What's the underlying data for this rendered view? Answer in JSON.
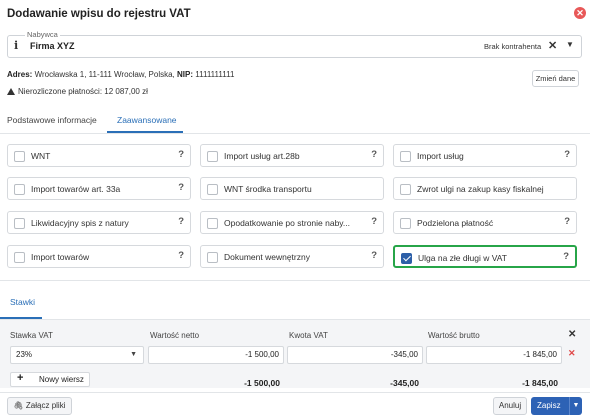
{
  "dialog": {
    "title": "Dodawanie wpisu do rejestru VAT"
  },
  "buyer": {
    "legend": "Nabywca",
    "name": "Firma XYZ",
    "tag": "Brak kontrahenta",
    "clear_icon": "close-icon",
    "caret_icon": "caret-down-icon"
  },
  "address": {
    "label_adres": "Adres:",
    "address_text": "Wrocławska 1, 11-111 Wrocław, Polska,",
    "label_nip": "NIP:",
    "nip": "1111111111",
    "unpaid": "Nierozliczone płatności: 12 087,00 zł",
    "change_button": "Zmień dane"
  },
  "tabs": [
    {
      "label": "Podstawowe informacje",
      "active": false
    },
    {
      "label": "Zaawansowane",
      "active": true
    }
  ],
  "options": [
    {
      "label": "WNT",
      "checked": false,
      "help": "?"
    },
    {
      "label": "Import usług art.28b",
      "checked": false,
      "help": "?"
    },
    {
      "label": "Import usług",
      "checked": false,
      "help": "?"
    },
    {
      "label": "Import towarów art. 33a",
      "checked": false,
      "help": "?"
    },
    {
      "label": "WNT środka transportu",
      "checked": false,
      "help": ""
    },
    {
      "label": "Zwrot ulgi na zakup kasy fiskalnej",
      "checked": false,
      "help": ""
    },
    {
      "label": "Likwidacyjny spis z natury",
      "checked": false,
      "help": "?"
    },
    {
      "label": "Opodatkowanie po stronie naby...",
      "checked": false,
      "help": "?"
    },
    {
      "label": "Podzielona płatność",
      "checked": false,
      "help": "?"
    },
    {
      "label": "Import towarów",
      "checked": false,
      "help": "?"
    },
    {
      "label": "Dokument wewnętrzny",
      "checked": false,
      "help": "?"
    },
    {
      "label": "Ulga na złe długi w VAT",
      "checked": true,
      "help": "?"
    }
  ],
  "rates": {
    "tab_label": "Stawki",
    "headers": [
      "Stawka VAT",
      "Wartość netto",
      "Kwota VAT",
      "Wartość brutto"
    ],
    "row": {
      "rate": "23%",
      "net": "-1 500,00",
      "vat": "-345,00",
      "gross": "-1 845,00"
    },
    "new_row_label": "Nowy wiersz",
    "totals": {
      "net": "-1 500,00",
      "vat": "-345,00",
      "gross": "-1 845,00"
    }
  },
  "footer": {
    "attach_label": "Załącz pliki",
    "cancel_label": "Anuluj",
    "save_label": "Zapisz"
  },
  "colors": {
    "accent": "#2a6fb7",
    "selected_border": "#27a548",
    "checkbox_on": "#2d5fa8",
    "danger": "#e85858"
  }
}
